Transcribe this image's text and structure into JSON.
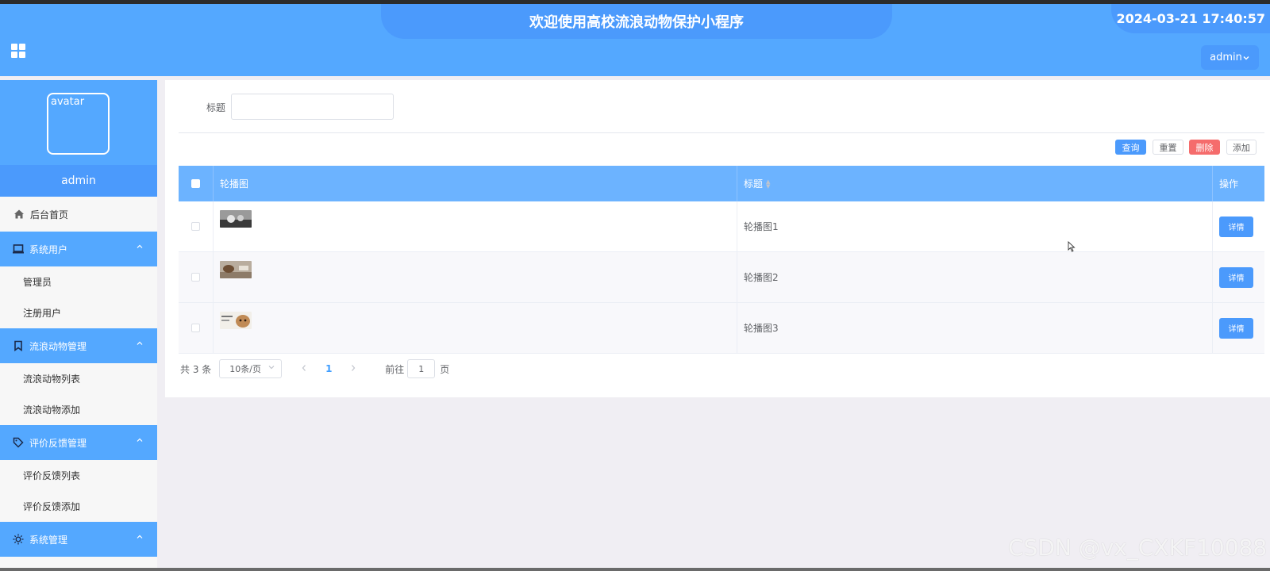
{
  "header": {
    "title": "欢迎使用高校流浪动物保护小程序",
    "datetime": "2024-03-21 17:40:57",
    "user_menu": "admin"
  },
  "sidebar": {
    "avatar_alt": "avatar",
    "username": "admin",
    "home": "后台首页",
    "groups": [
      {
        "label": "系统用户",
        "icon": "laptop-icon",
        "items": [
          "管理员",
          "注册用户"
        ]
      },
      {
        "label": "流浪动物管理",
        "icon": "bookmark-icon",
        "items": [
          "流浪动物列表",
          "流浪动物添加"
        ]
      },
      {
        "label": "评价反馈管理",
        "icon": "tag-icon",
        "items": [
          "评价反馈列表",
          "评价反馈添加"
        ]
      },
      {
        "label": "系统管理",
        "icon": "sun-icon",
        "items": []
      }
    ]
  },
  "search": {
    "label": "标题",
    "value": ""
  },
  "toolbar": {
    "query": "查询",
    "reset": "重置",
    "delete": "删除",
    "add": "添加"
  },
  "table": {
    "columns": [
      "轮播图",
      "标题",
      "操作"
    ],
    "rows": [
      {
        "title": "轮播图1",
        "action": "详情",
        "thumb_color": "#7d7d7d"
      },
      {
        "title": "轮播图2",
        "action": "详情",
        "thumb_color": "#a08a72"
      },
      {
        "title": "轮播图3",
        "action": "详情",
        "thumb_color": "#c9a276"
      }
    ]
  },
  "pagination": {
    "total": "共 3 条",
    "page_size": "10条/页",
    "current_page": "1",
    "goto_label": "前往",
    "goto_value": "1",
    "page_suffix": "页"
  },
  "watermark": "CSDN @vx_CXKF10088",
  "colors": {
    "primary": "#54a8ff",
    "primary_dark": "#4b9afc",
    "danger": "#f56c6c"
  }
}
